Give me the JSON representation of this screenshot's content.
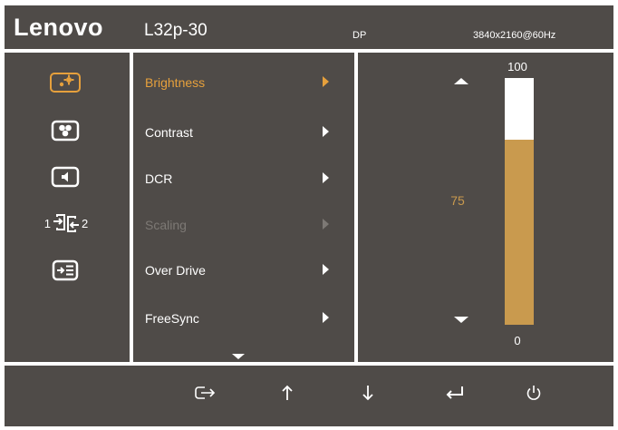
{
  "header": {
    "brand": "Lenovo",
    "model": "L32p-30",
    "input": "DP",
    "resolution": "3840x2160@60Hz"
  },
  "categories": [
    {
      "icon": "brightness-icon"
    },
    {
      "icon": "color-icon"
    },
    {
      "icon": "audio-icon"
    },
    {
      "icon": "input-switch-icon",
      "label_left": "1",
      "label_right": "2"
    },
    {
      "icon": "menu-settings-icon"
    }
  ],
  "menu": {
    "items": [
      {
        "label": "Brightness",
        "state": "active"
      },
      {
        "label": "Contrast",
        "state": "normal"
      },
      {
        "label": "DCR",
        "state": "normal"
      },
      {
        "label": "Scaling",
        "state": "disabled"
      },
      {
        "label": "Over Drive",
        "state": "normal"
      },
      {
        "label": "FreeSync",
        "state": "normal"
      }
    ]
  },
  "slider": {
    "max": "100",
    "min": "0",
    "value": "75",
    "level": 0.75
  },
  "footer": {
    "buttons": [
      "exit-icon",
      "up-arrow-icon",
      "down-arrow-icon",
      "enter-icon",
      "power-icon"
    ]
  },
  "colors": {
    "background": "#4f4b48",
    "accent": "#e6a03c",
    "slider_fill": "#c99a4e",
    "disabled": "#7d7975"
  }
}
